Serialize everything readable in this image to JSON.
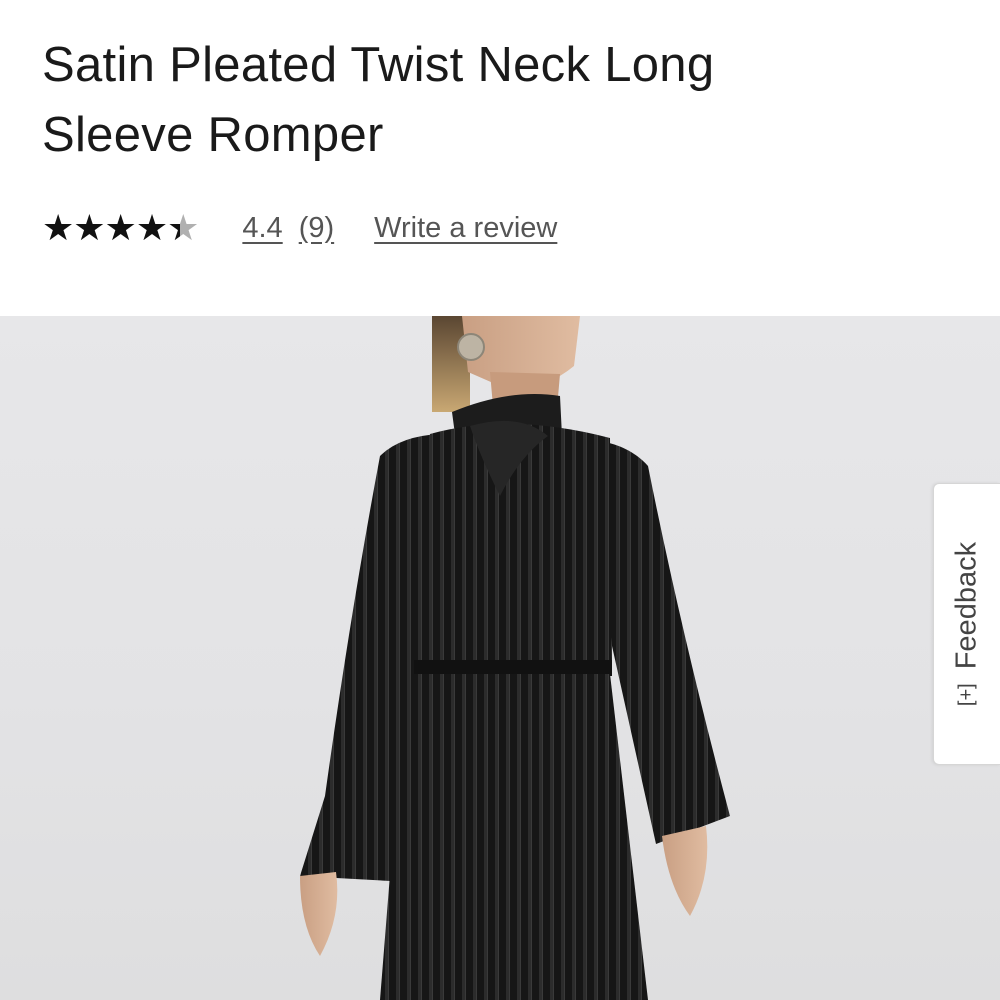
{
  "product": {
    "title_line1": "Satin Pleated Twist Neck Long",
    "title_line2": "Sleeve Romper",
    "rating": {
      "stars_glyphs": "★★★★★",
      "max_stars": 5,
      "value": 4.4,
      "value_text": "4.4",
      "count_text": "(9)"
    },
    "write_review_label": "Write a review"
  },
  "image": {
    "subject": "model wearing black pleated satin romper",
    "background_color": "#e5e5e7",
    "garment_color": "#141414"
  },
  "feedback": {
    "icon": "plus-box-icon",
    "icon_glyph": "[+]",
    "label": "Feedback"
  }
}
